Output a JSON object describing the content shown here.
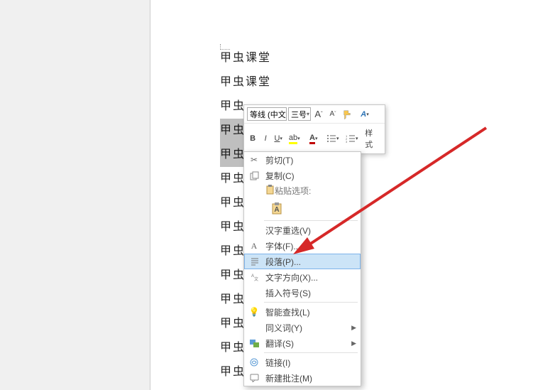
{
  "document": {
    "lines": [
      "甲虫课堂",
      "甲虫课堂",
      "甲虫",
      "甲虫",
      "甲虫",
      "甲虫",
      "甲虫",
      "甲虫",
      "甲虫",
      "甲虫",
      "甲虫",
      "甲虫",
      "甲虫课堂",
      "甲虫课堂"
    ],
    "selectedRange": [
      3,
      4
    ]
  },
  "miniToolbar": {
    "fontName": "等线 (中文",
    "fontSize": "三号",
    "grow": "A",
    "shrink": "A",
    "bold": "B",
    "italic": "I",
    "underline": "U",
    "fontColorLetter": "A",
    "stylesLabel": "样式"
  },
  "contextMenu": {
    "cut": "剪切(T)",
    "copy": "复制(C)",
    "pasteOptionsLabel": "粘贴选项:",
    "reselect": "汉字重选(V)",
    "font": "字体(F)...",
    "paragraph": "段落(P)...",
    "textDirection": "文字方向(X)...",
    "insertSymbol": "插入符号(S)",
    "smartLookup": "智能查找(L)",
    "synonyms": "同义词(Y)",
    "translate": "翻译(S)",
    "link": "链接(I)",
    "newComment": "新建批注(M)"
  }
}
